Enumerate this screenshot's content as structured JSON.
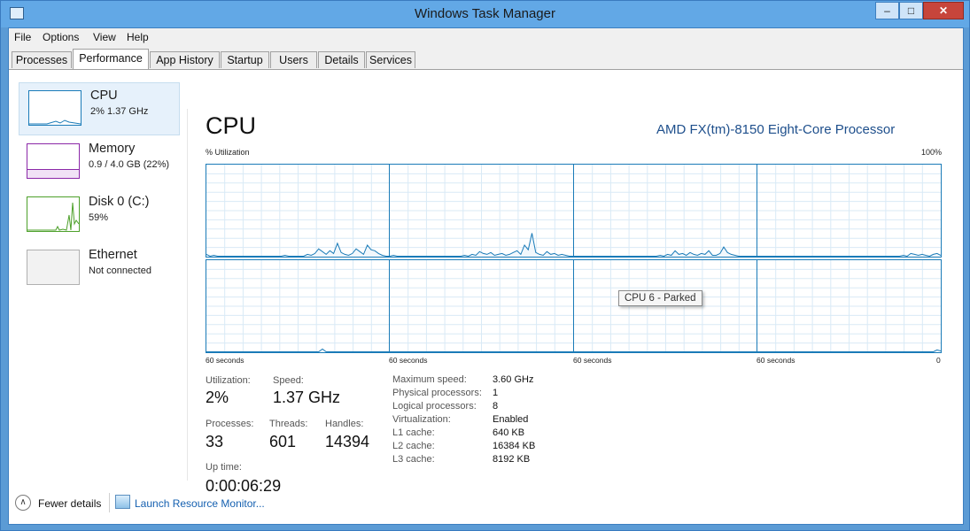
{
  "window": {
    "title": "Windows Task Manager"
  },
  "menu": [
    "File",
    "Options",
    "View",
    "Help"
  ],
  "tabs": [
    "Processes",
    "Performance",
    "App History",
    "Startup",
    "Users",
    "Details",
    "Services"
  ],
  "active_tab": "Performance",
  "sidebar": [
    {
      "title": "CPU",
      "sub": "2% 1.37 GHz",
      "color": "#1a7bb8",
      "selected": true
    },
    {
      "title": "Memory",
      "sub": "0.9 / 4.0 GB (22%)",
      "color": "#8b28a8",
      "selected": false
    },
    {
      "title": "Disk 0 (C:)",
      "sub": "59%",
      "color": "#4da02a",
      "selected": false
    },
    {
      "title": "Ethernet",
      "sub": "Not connected",
      "color": "#b0b0b0",
      "selected": false
    }
  ],
  "main": {
    "title": "CPU",
    "processor": "AMD FX(tm)-8150 Eight-Core Processor",
    "util_label": "% Utilization",
    "util_max": "100%",
    "time_label": "60 seconds",
    "time_zero": "0",
    "tooltip": "CPU 6 - Parked"
  },
  "stats": {
    "utilization": {
      "label": "Utilization:",
      "value": "2%"
    },
    "speed": {
      "label": "Speed:",
      "value": "1.37 GHz"
    },
    "processes": {
      "label": "Processes:",
      "value": "33"
    },
    "threads": {
      "label": "Threads:",
      "value": "601"
    },
    "handles": {
      "label": "Handles:",
      "value": "14394"
    },
    "uptime": {
      "label": "Up time:",
      "value": "0:00:06:29"
    }
  },
  "specs": [
    {
      "label": "Maximum speed:",
      "value": "3.60 GHz"
    },
    {
      "label": "Physical processors:",
      "value": "1"
    },
    {
      "label": "Logical processors:",
      "value": "8"
    },
    {
      "label": "Virtualization:",
      "value": "Enabled"
    },
    {
      "label": "L1 cache:",
      "value": "640 KB"
    },
    {
      "label": "L2 cache:",
      "value": "16384 KB"
    },
    {
      "label": "L3 cache:",
      "value": "8192 KB"
    }
  ],
  "footer": {
    "fewer": "Fewer details",
    "link": "Launch Resource Monitor..."
  },
  "cpu_graphs": [
    [
      2,
      0,
      1,
      0,
      0,
      0,
      0,
      0,
      0,
      0,
      0,
      0,
      0,
      0,
      0,
      0,
      0,
      0,
      0,
      0,
      0,
      1,
      0,
      0,
      0,
      0,
      0,
      2,
      1,
      3,
      8,
      5,
      2,
      6,
      3,
      14,
      4,
      2,
      1,
      3,
      8,
      5,
      2,
      12,
      7,
      6,
      3,
      1,
      0,
      0
    ],
    [
      0,
      1,
      0,
      0,
      0,
      0,
      0,
      0,
      0,
      0,
      0,
      0,
      0,
      0,
      0,
      0,
      0,
      0,
      0,
      0,
      1,
      0,
      2,
      1,
      5,
      3,
      2,
      4,
      1,
      2,
      3,
      1,
      2,
      4,
      6,
      2,
      12,
      7,
      25,
      4,
      2,
      1,
      5,
      2,
      3,
      1,
      2,
      1,
      0,
      0
    ],
    [
      0,
      0,
      0,
      0,
      0,
      0,
      0,
      0,
      0,
      0,
      0,
      0,
      0,
      0,
      0,
      0,
      0,
      0,
      0,
      0,
      0,
      0,
      0,
      1,
      0,
      2,
      1,
      6,
      2,
      3,
      1,
      4,
      2,
      1,
      3,
      2,
      6,
      1,
      1,
      3,
      10,
      4,
      2,
      1,
      0,
      0,
      0,
      0,
      0,
      0
    ],
    [
      0,
      0,
      0,
      0,
      0,
      0,
      0,
      0,
      0,
      0,
      0,
      0,
      0,
      0,
      0,
      0,
      0,
      0,
      0,
      0,
      0,
      0,
      0,
      0,
      0,
      0,
      0,
      0,
      0,
      0,
      0,
      0,
      0,
      0,
      0,
      0,
      0,
      0,
      0,
      1,
      0,
      3,
      2,
      1,
      2,
      1,
      0,
      2,
      3,
      1
    ],
    [
      0,
      0,
      0,
      0,
      0,
      0,
      0,
      0,
      0,
      0,
      0,
      0,
      0,
      0,
      0,
      0,
      0,
      0,
      0,
      0,
      0,
      0,
      0,
      0,
      0,
      0,
      0,
      0,
      0,
      0,
      0,
      3,
      0,
      0,
      0,
      0,
      0,
      0,
      0,
      0,
      0,
      0,
      0,
      0,
      0,
      0,
      0,
      0,
      0,
      0
    ],
    [
      0,
      0,
      0,
      0,
      0,
      0,
      0,
      0,
      0,
      0,
      0,
      0,
      0,
      0,
      0,
      0,
      0,
      0,
      0,
      0,
      0,
      0,
      0,
      0,
      0,
      0,
      0,
      0,
      0,
      0,
      0,
      0,
      0,
      0,
      0,
      0,
      0,
      0,
      0,
      0,
      0,
      0,
      0,
      0,
      0,
      0,
      0,
      0,
      0,
      0
    ],
    [
      0,
      0,
      0,
      0,
      0,
      0,
      0,
      0,
      0,
      0,
      0,
      0,
      0,
      0,
      0,
      0,
      0,
      0,
      0,
      0,
      0,
      0,
      0,
      0,
      0,
      0,
      0,
      0,
      0,
      0,
      0,
      0,
      0,
      0,
      0,
      0,
      0,
      0,
      0,
      0,
      0,
      0,
      0,
      0,
      0,
      0,
      0,
      0,
      0,
      0
    ],
    [
      0,
      0,
      0,
      0,
      0,
      0,
      0,
      0,
      0,
      0,
      0,
      0,
      0,
      0,
      0,
      0,
      0,
      0,
      0,
      0,
      0,
      0,
      0,
      0,
      0,
      0,
      0,
      0,
      0,
      0,
      0,
      0,
      0,
      0,
      0,
      0,
      0,
      0,
      0,
      0,
      0,
      0,
      0,
      0,
      0,
      0,
      0,
      0,
      2,
      1
    ]
  ]
}
